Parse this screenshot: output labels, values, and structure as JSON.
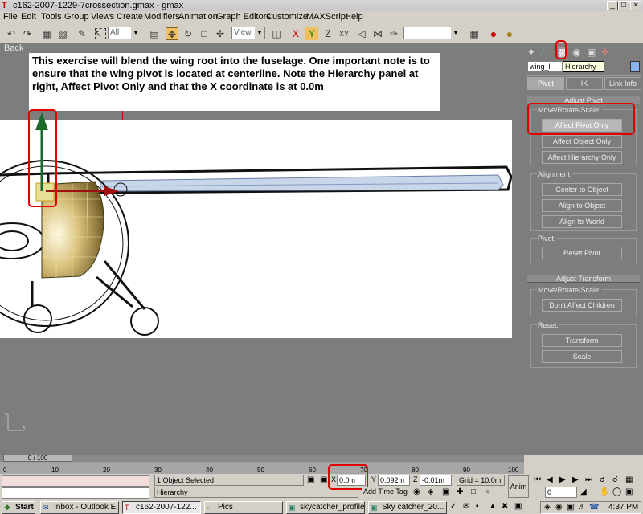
{
  "window": {
    "title": "c162-2007-1229-7crossection.gmax - gmax",
    "min": "_",
    "max": "□",
    "close": "×"
  },
  "menu": [
    "File",
    "Edit",
    "Tools",
    "Group",
    "Views",
    "Create",
    "Modifiers",
    "Animation",
    "Graph Editors",
    "Customize",
    "MAXScript",
    "Help"
  ],
  "toolbar": {
    "filter": "All",
    "coord": "View"
  },
  "viewport": {
    "label": "Back",
    "note": "This exercise will blend the wing root into the fuselage.  One important note is to ensure that the wing pivot is located at centerline.  Note the Hierarchy panel at right, Affect Pivot Only and that the X coordinate is at 0.0m"
  },
  "panel": {
    "object_name": "wing_l",
    "tooltip": "Hierarchy",
    "tabs": [
      "Pivot",
      "IK",
      "Link Info"
    ],
    "adjust_pivot": "Adjust Pivot",
    "mrs": "Move/Rotate/Scale:",
    "affect_pivot": "Affect Pivot Only",
    "affect_object": "Affect Object Only",
    "affect_hierarchy": "Affect Hierarchy Only",
    "alignment": "Alignment:",
    "center": "Center to Object",
    "align_obj": "Align to Object",
    "align_world": "Align to World",
    "pivot": "Pivot:",
    "reset_pivot": "Reset Pivot",
    "adjust_transform": "Adjust Transform",
    "mrs2": "Move/Rotate/Scale:",
    "dont_affect": "Don't Affect Children",
    "reset": "Reset:",
    "transform": "Transform",
    "scale": "Scale"
  },
  "timeline": {
    "slider": "0 / 100",
    "ticks": [
      "0",
      "10",
      "20",
      "30",
      "40",
      "50",
      "60",
      "70",
      "80",
      "90",
      "100"
    ]
  },
  "status": {
    "selected": "1 Object Selected",
    "prompt": "Hierarchy",
    "x_label": "X",
    "x": "0.0m",
    "y_label": "Y",
    "y": "0.092m",
    "z_label": "Z",
    "z": "-0.01m",
    "grid": "Grid = 10.0m",
    "add_time_tag": "Add Time Tag",
    "anim": "Anim",
    "frame": "0"
  },
  "taskbar": {
    "start": "Start",
    "items": [
      "Inbox - Outlook E...",
      "c162-2007-122...",
      "Pics",
      "skycatcher_profile....",
      "Sky catcher_20..."
    ],
    "clock": "4:37 PM"
  },
  "colors": {
    "viewport": "#7d7d7d",
    "highlight": "#e00000"
  }
}
